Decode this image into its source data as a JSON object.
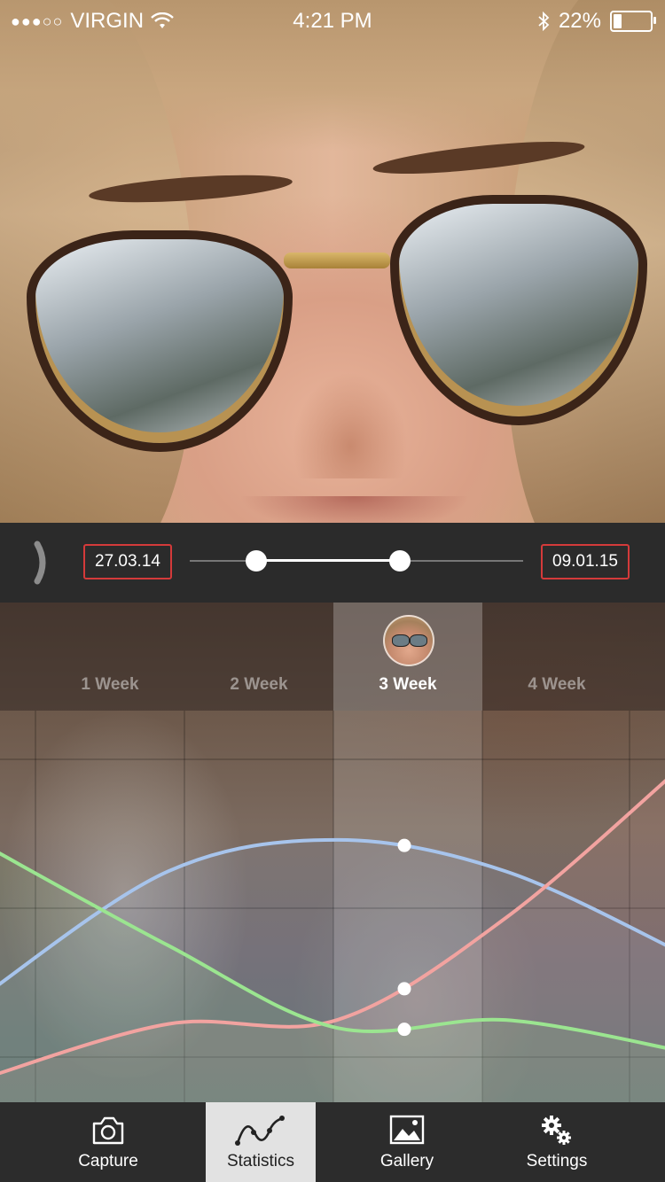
{
  "status_bar": {
    "carrier": "VIRGIN",
    "signal_dots": "●●●○○",
    "time": "4:21 PM",
    "battery_percent": "22%",
    "battery_level": 0.22
  },
  "date_range": {
    "start": "27.03.14",
    "end": "09.01.15",
    "slider_low": 0.2,
    "slider_high": 0.63
  },
  "weeks": {
    "items": [
      "1 Week",
      "2 Week",
      "3 Week",
      "4 Week"
    ],
    "selected_index": 2
  },
  "chart_data": {
    "type": "line",
    "x": [
      0,
      1,
      2,
      3,
      4
    ],
    "series": [
      {
        "color": "#a7c4ec",
        "values": [
          0.27,
          0.59,
          0.67,
          0.59,
          0.38
        ]
      },
      {
        "color": "#f2a3a0",
        "values": [
          0.06,
          0.2,
          0.21,
          0.47,
          0.86
        ]
      },
      {
        "color": "#9be590",
        "values": [
          0.66,
          0.4,
          0.19,
          0.21,
          0.13
        ]
      }
    ],
    "highlight_x": 2.4,
    "grid": true
  },
  "tabs": [
    {
      "label": "Capture",
      "icon": "camera-icon"
    },
    {
      "label": "Statistics",
      "icon": "line-chart-icon",
      "active": true
    },
    {
      "label": "Gallery",
      "icon": "image-icon"
    },
    {
      "label": "Settings",
      "icon": "gears-icon"
    }
  ]
}
